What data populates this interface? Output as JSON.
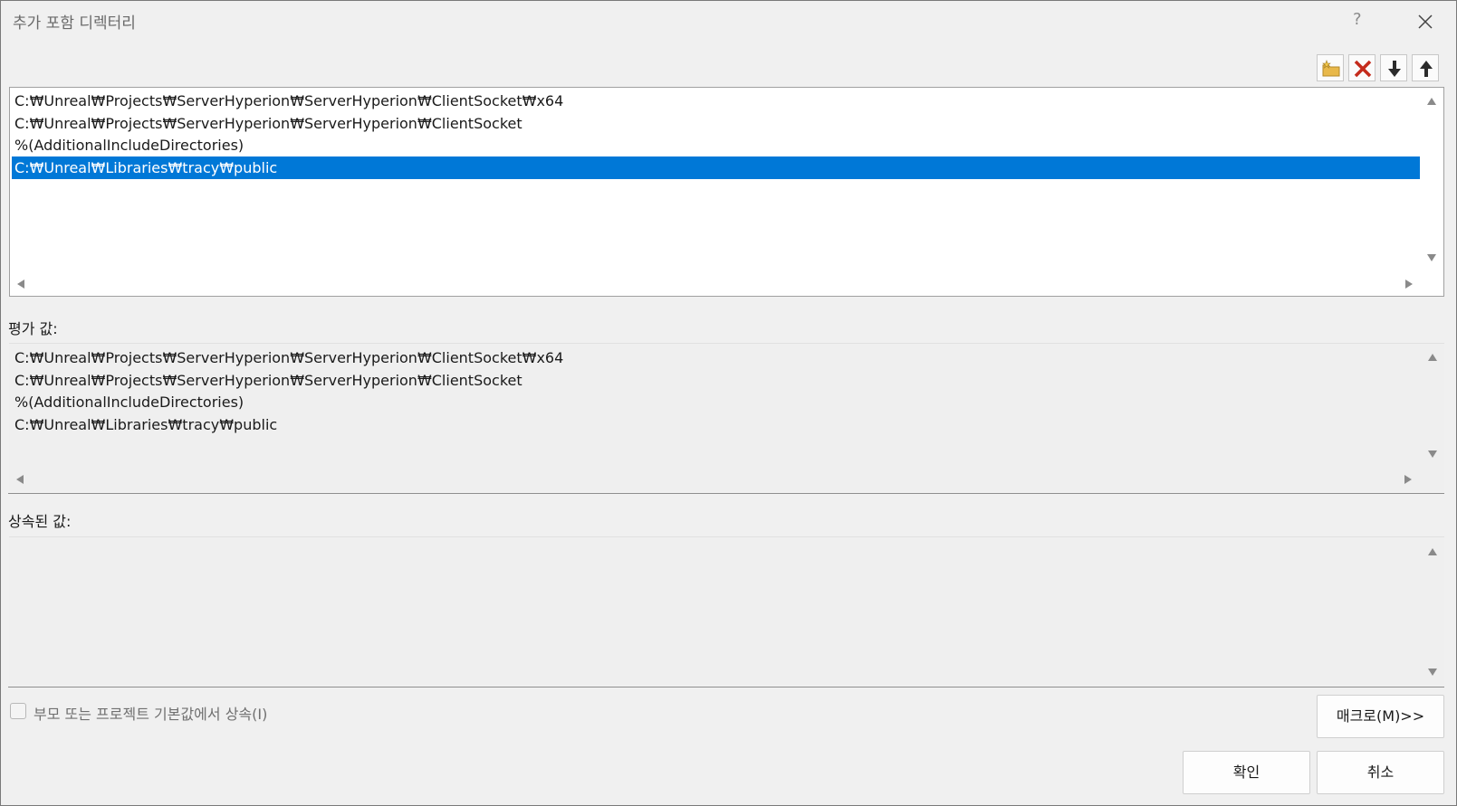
{
  "window": {
    "title": "추가 포함 디렉터리",
    "help_label": "?",
    "close_icon": "close-icon"
  },
  "toolbar": {
    "buttons": [
      {
        "name": "new-line-button",
        "icon": "folder-new-icon"
      },
      {
        "name": "delete-line-button",
        "icon": "delete-x-icon"
      },
      {
        "name": "move-down-button",
        "icon": "arrow-down-icon"
      },
      {
        "name": "move-up-button",
        "icon": "arrow-up-icon"
      }
    ],
    "colors": {
      "delete": "#c42b1c",
      "folder": "#e8b84a",
      "arrow": "#2b2b2b"
    }
  },
  "editor": {
    "lines": [
      "C:₩Unreal₩Projects₩ServerHyperion₩ServerHyperion₩ClientSocket₩x64",
      "C:₩Unreal₩Projects₩ServerHyperion₩ServerHyperion₩ClientSocket",
      "%(AdditionalIncludeDirectories)",
      "C:₩Unreal₩Libraries₩tracy₩public"
    ],
    "selected_index": 3,
    "selection_color": "#0078d7"
  },
  "evaluated": {
    "label": "평가 값:",
    "lines": [
      "C:₩Unreal₩Projects₩ServerHyperion₩ServerHyperion₩ClientSocket₩x64",
      "C:₩Unreal₩Projects₩ServerHyperion₩ServerHyperion₩ClientSocket",
      "%(AdditionalIncludeDirectories)",
      "C:₩Unreal₩Libraries₩tracy₩public"
    ]
  },
  "inherited": {
    "label": "상속된 값:",
    "lines": []
  },
  "inherit_checkbox": {
    "label": "부모 또는 프로젝트 기본값에서 상속(I)",
    "checked": false
  },
  "buttons": {
    "macros": "매크로(M)>>",
    "ok": "확인",
    "cancel": "취소"
  }
}
